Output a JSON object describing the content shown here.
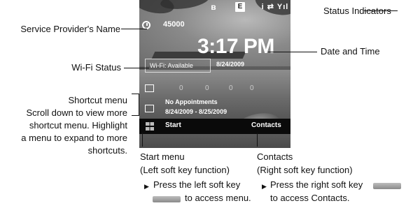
{
  "phone": {
    "status_icons": {
      "bluetooth": "bluetooth-icon",
      "e": "E",
      "signal": "i ⇄ Yıl"
    },
    "provider_name": "45000",
    "time": "3:17 PM",
    "wifi_status": "Wi-Fi: Available",
    "date": "8/24/2009",
    "counters": [
      "0",
      "0",
      "0",
      "0"
    ],
    "appointments_title": "No Appointments",
    "appointments_range": "8/24/2009 - 8/25/2009",
    "softkey_left": "Start",
    "softkey_right": "Contacts"
  },
  "labels": {
    "status_indicators": "Status Indicators",
    "service_provider": "Service Provider's Name",
    "date_time": "Date and Time",
    "wifi_status": "Wi-Fi Status",
    "shortcut_menu": "Shortcut menu",
    "shortcut_desc": [
      "Scroll down to view more",
      "shortcut menu. Highlight",
      "a menu to expand to more",
      "shortcuts."
    ],
    "start_menu": "Start menu",
    "start_menu_sub": "(Left soft key function)",
    "contacts": "Contacts",
    "contacts_sub": "(Right soft key function)",
    "left_instr_1": "Press the left soft key",
    "left_instr_2": "to access menu.",
    "right_instr_1": "Press the right soft key",
    "right_instr_2": "to access Contacts."
  }
}
